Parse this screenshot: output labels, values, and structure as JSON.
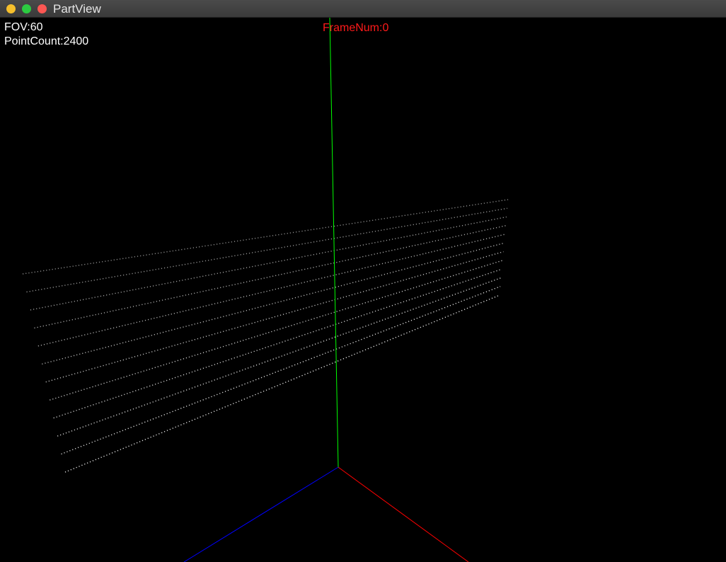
{
  "window": {
    "title": "PartView"
  },
  "hud": {
    "fov": "FOV:60",
    "point_count": "PointCount:2400",
    "frame_num": "FrameNum:0"
  },
  "scene": {
    "background_color": "#000000",
    "axis_colors": {
      "x": "#ff0000",
      "y": "#00ff00",
      "z": "#0000ff"
    },
    "point_color": "#ffffff",
    "line_count": 12
  }
}
